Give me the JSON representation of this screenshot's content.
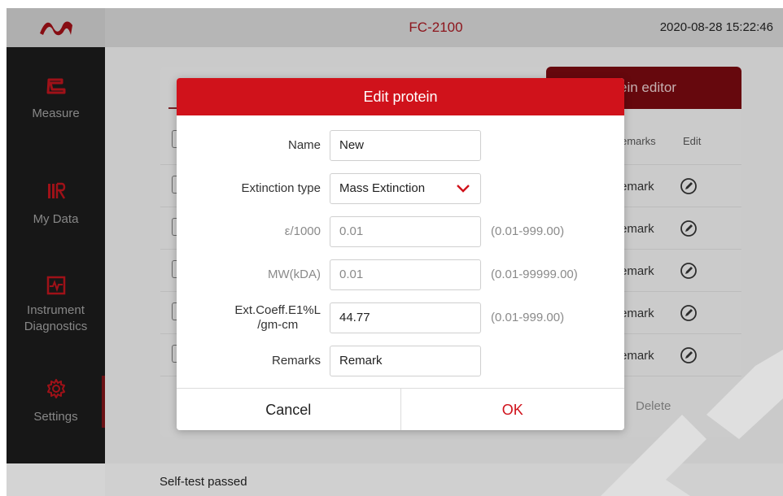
{
  "app": {
    "title": "FC-2100",
    "datetime": "2020-08-28 15:22:46",
    "logo_icon": "wave-logo-icon",
    "accent_color": "#d0121b"
  },
  "sidebar": {
    "items": [
      {
        "label": "Measure",
        "icon": "measure-icon"
      },
      {
        "label": "My Data",
        "icon": "my-data-icon"
      },
      {
        "label": "Instrument\nDiagnostics",
        "icon": "diagnostics-icon"
      },
      {
        "label": "Settings",
        "icon": "gear-icon",
        "active": true
      }
    ]
  },
  "background_table": {
    "active_tab": "ein editor",
    "columns": {
      "remarks": "emarks",
      "edit": "Edit"
    },
    "rows": [
      {
        "remark": "emark"
      },
      {
        "remark": "emark"
      },
      {
        "remark": "emark"
      },
      {
        "remark": "emark"
      },
      {
        "remark": "emark"
      }
    ],
    "delete_label": "Delete"
  },
  "status": {
    "text": "Self-test passed"
  },
  "dialog": {
    "title": "Edit protein",
    "fields": {
      "name": {
        "label": "Name",
        "value": "New"
      },
      "extinction_type": {
        "label": "Extinction type",
        "value": "Mass Extinction"
      },
      "epsilon": {
        "label": "ε/1000",
        "value": "0.01",
        "hint": "(0.01-999.00)"
      },
      "mw": {
        "label": "MW(kDA)",
        "value": "0.01",
        "hint": "(0.01-99999.00)"
      },
      "ext_coeff": {
        "label": "Ext.Coeff.E1%L\n/gm-cm",
        "value": "44.77",
        "hint": "(0.01-999.00)"
      },
      "remarks": {
        "label": "Remarks",
        "value": "Remark"
      }
    },
    "cancel_label": "Cancel",
    "ok_label": "OK"
  }
}
